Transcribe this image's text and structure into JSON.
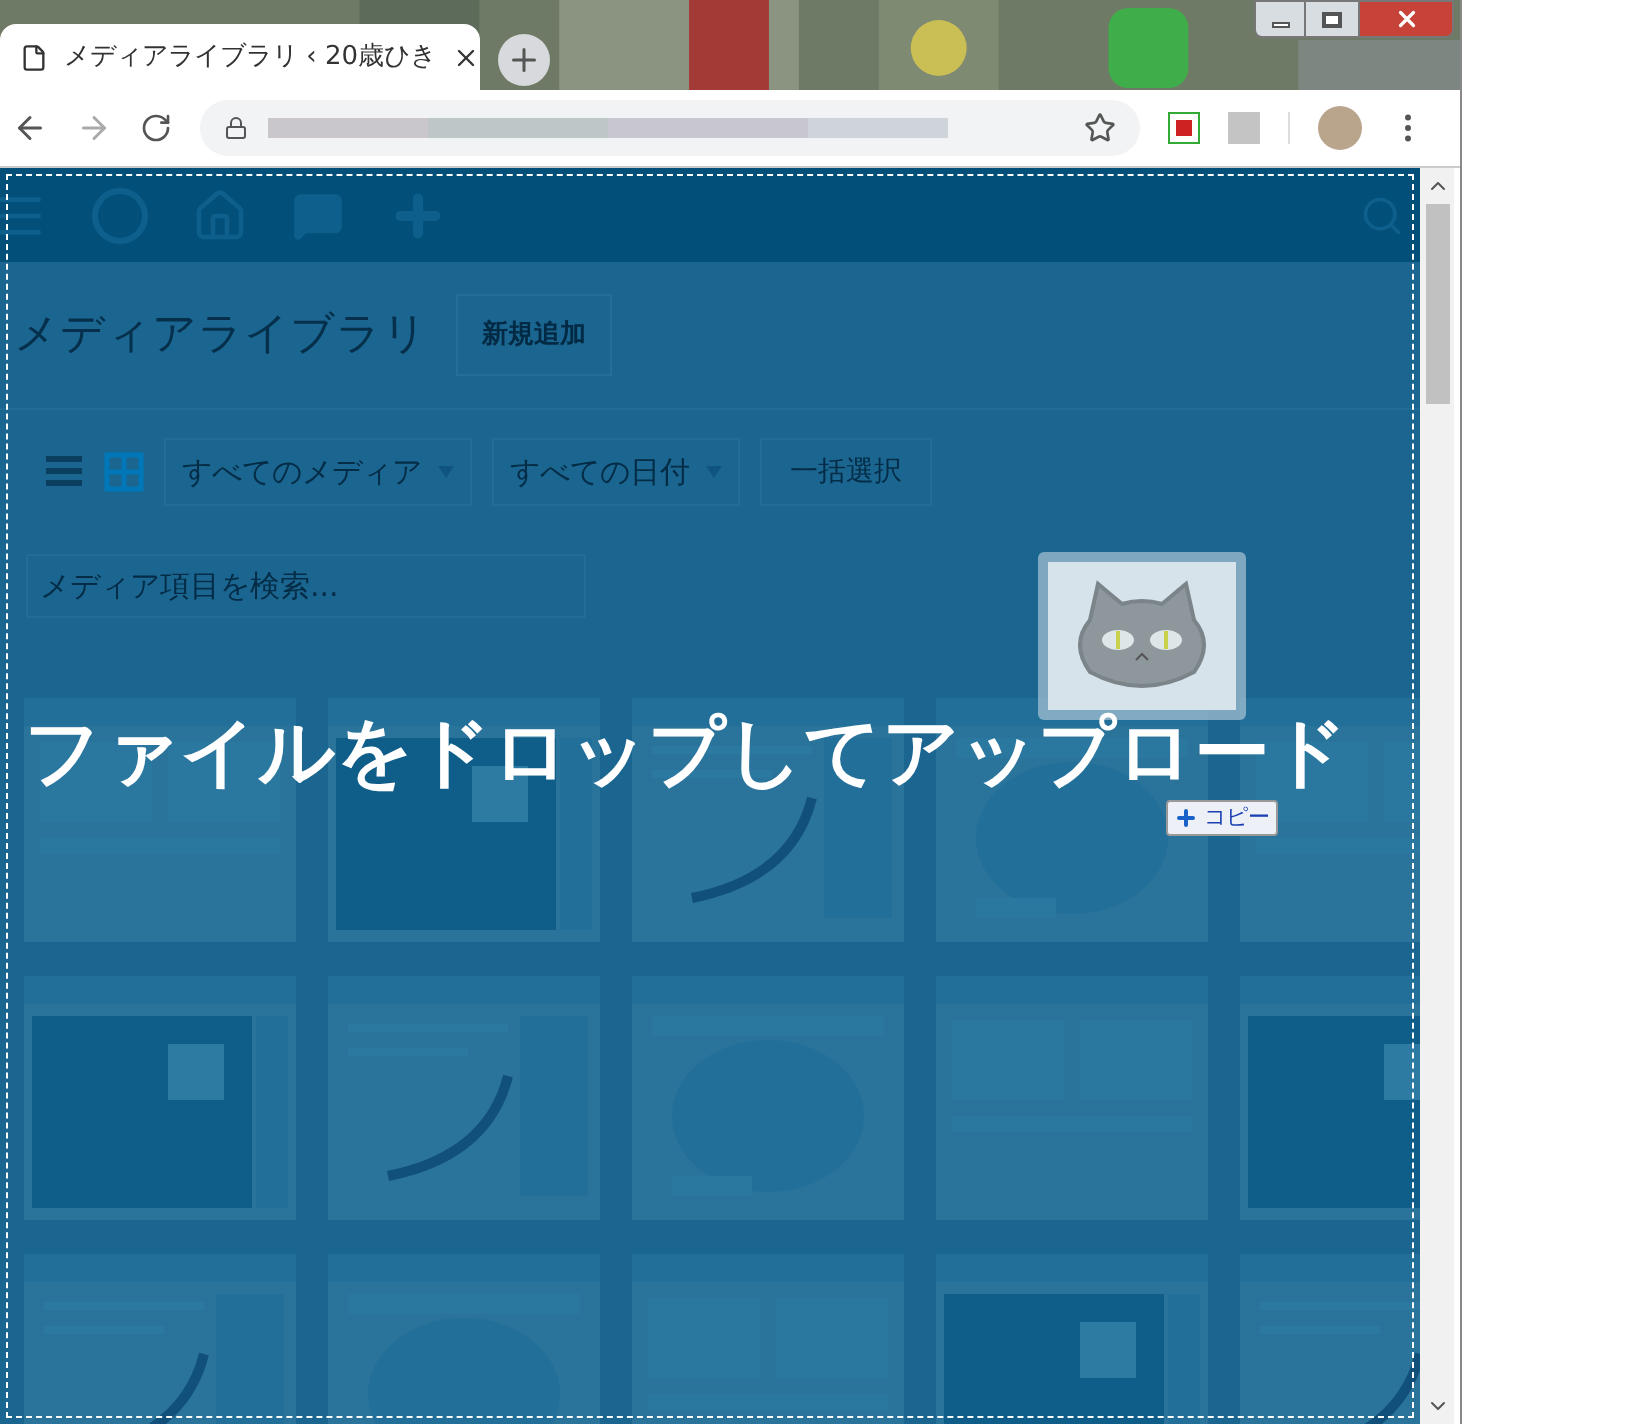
{
  "browser": {
    "tab": {
      "title": "メディアライブラリ ‹ 20歳ひき"
    }
  },
  "page": {
    "title": "メディアライブラリ",
    "add_new_button": "新規追加",
    "view_modes": [
      {
        "kind": "list",
        "selected": false
      },
      {
        "kind": "grid",
        "selected": true
      }
    ],
    "filters": [
      "すべてのメディア",
      "すべての日付"
    ],
    "bulk_select_button": "一括選択",
    "search": {
      "placeholder": "メディア項目を検索..."
    }
  },
  "drop_overlay": {
    "message": "ファイルをドロップしてアップロード",
    "drag_badge": "コピー"
  }
}
